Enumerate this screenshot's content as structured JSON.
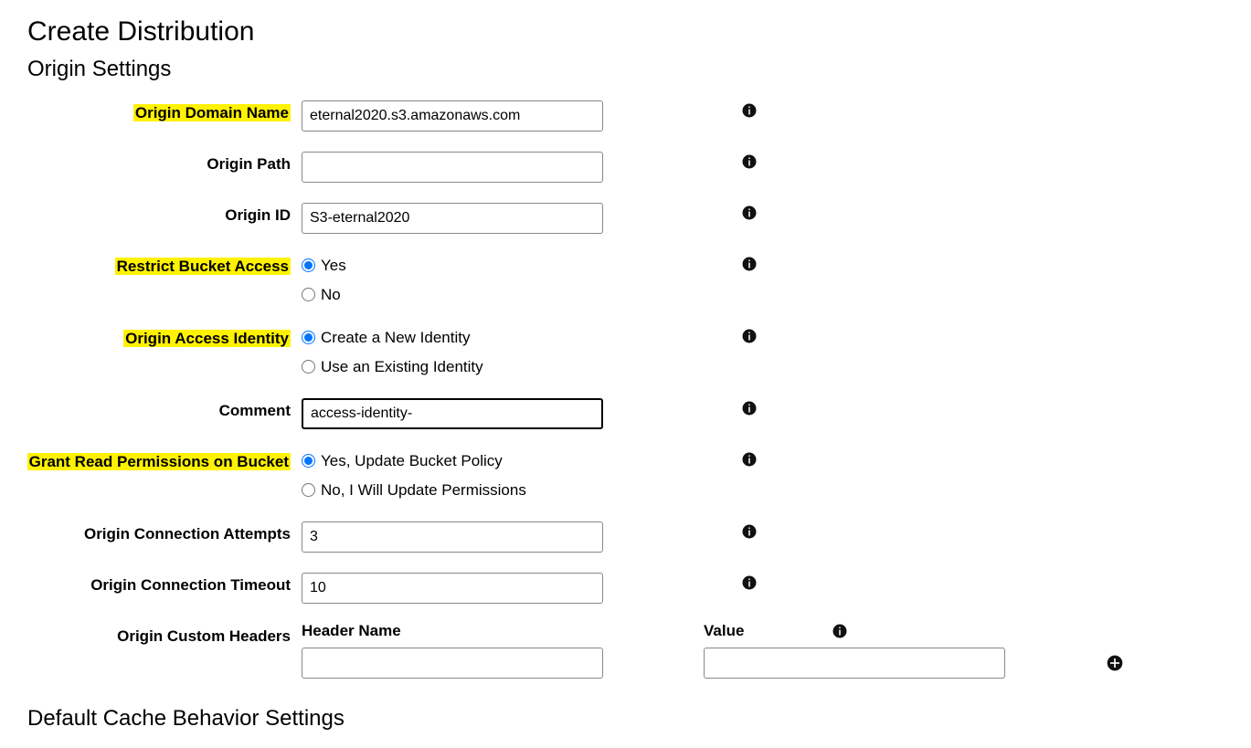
{
  "page": {
    "title": "Create Distribution",
    "section1": "Origin Settings",
    "section2": "Default Cache Behavior Settings"
  },
  "labels": {
    "originDomainName": "Origin Domain Name",
    "originPath": "Origin Path",
    "originId": "Origin ID",
    "restrictBucketAccess": "Restrict Bucket Access",
    "originAccessIdentity": "Origin Access Identity",
    "comment": "Comment",
    "grantReadPermissions": "Grant Read Permissions on Bucket",
    "originConnectionAttempts": "Origin Connection Attempts",
    "originConnectionTimeout": "Origin Connection Timeout",
    "originCustomHeaders": "Origin Custom Headers",
    "headerName": "Header Name",
    "value": "Value"
  },
  "values": {
    "originDomainName": "eternal2020.s3.amazonaws.com",
    "originPath": "",
    "originId": "S3-eternal2020",
    "comment": "access-identity-",
    "originConnectionAttempts": "3",
    "originConnectionTimeout": "10",
    "headerName": "",
    "headerValue": ""
  },
  "radios": {
    "restrictBucketAccess": {
      "yes": "Yes",
      "no": "No",
      "selected": "yes"
    },
    "originAccessIdentity": {
      "create": "Create a New Identity",
      "existing": "Use an Existing Identity",
      "selected": "create"
    },
    "grantReadPermissions": {
      "yes": "Yes, Update Bucket Policy",
      "no": "No, I Will Update Permissions",
      "selected": "yes"
    }
  }
}
